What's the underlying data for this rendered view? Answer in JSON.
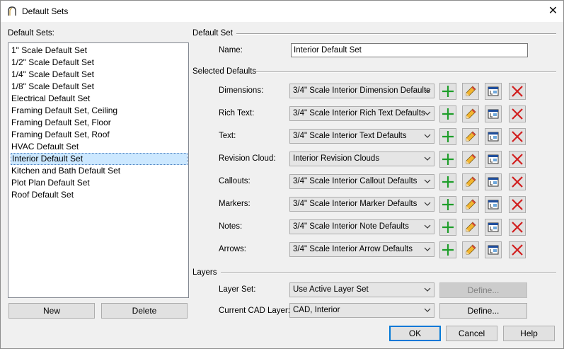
{
  "window": {
    "title": "Default Sets",
    "close_glyph": "✕"
  },
  "left": {
    "label": "Default Sets:",
    "items": [
      "1\" Scale Default Set",
      "1/2\" Scale Default Set",
      "1/4\" Scale Default Set",
      "1/8\" Scale Default Set",
      "Electrical Default Set",
      "Framing Default Set, Ceiling",
      "Framing Default Set, Floor",
      "Framing Default Set, Roof",
      "HVAC Default Set",
      "Interior Default Set",
      "Kitchen and Bath Default Set",
      "Plot Plan Default Set",
      "Roof Default Set"
    ],
    "selected": "Interior Default Set",
    "new_label": "New",
    "delete_label": "Delete"
  },
  "default_set": {
    "group_label": "Default Set",
    "name_label": "Name:",
    "name_value": "Interior Default Set"
  },
  "selected_defaults": {
    "group_label": "Selected Defaults",
    "rows": [
      {
        "label": "Dimensions:",
        "value": "3/4\" Scale Interior Dimension Defaults"
      },
      {
        "label": "Rich Text:",
        "value": "3/4\" Scale Interior Rich Text Defaults"
      },
      {
        "label": "Text:",
        "value": "3/4\" Scale Interior Text Defaults"
      },
      {
        "label": "Revision Cloud:",
        "value": "Interior Revision Clouds"
      },
      {
        "label": "Callouts:",
        "value": "3/4\" Scale Interior Callout Defaults"
      },
      {
        "label": "Markers:",
        "value": "3/4\" Scale Interior Marker Defaults"
      },
      {
        "label": "Notes:",
        "value": "3/4\" Scale Interior Note Defaults"
      },
      {
        "label": "Arrows:",
        "value": "3/4\" Scale Interior Arrow Defaults"
      }
    ],
    "row_icons": [
      "add-icon",
      "edit-pencil-icon",
      "open-defaults-icon",
      "delete-x-icon"
    ]
  },
  "layers": {
    "group_label": "Layers",
    "layer_set_label": "Layer Set:",
    "layer_set_value": "Use Active Layer Set",
    "layer_set_define": "Define...",
    "cad_layer_label": "Current CAD Layer:",
    "cad_layer_value": "CAD, Interior",
    "cad_layer_define": "Define..."
  },
  "footer": {
    "ok": "OK",
    "cancel": "Cancel",
    "help": "Help"
  },
  "colors": {
    "selection": "#cce8ff",
    "focus_border": "#0078d7",
    "add_green": "#1e9e2a",
    "delete_red": "#d11f1f"
  }
}
